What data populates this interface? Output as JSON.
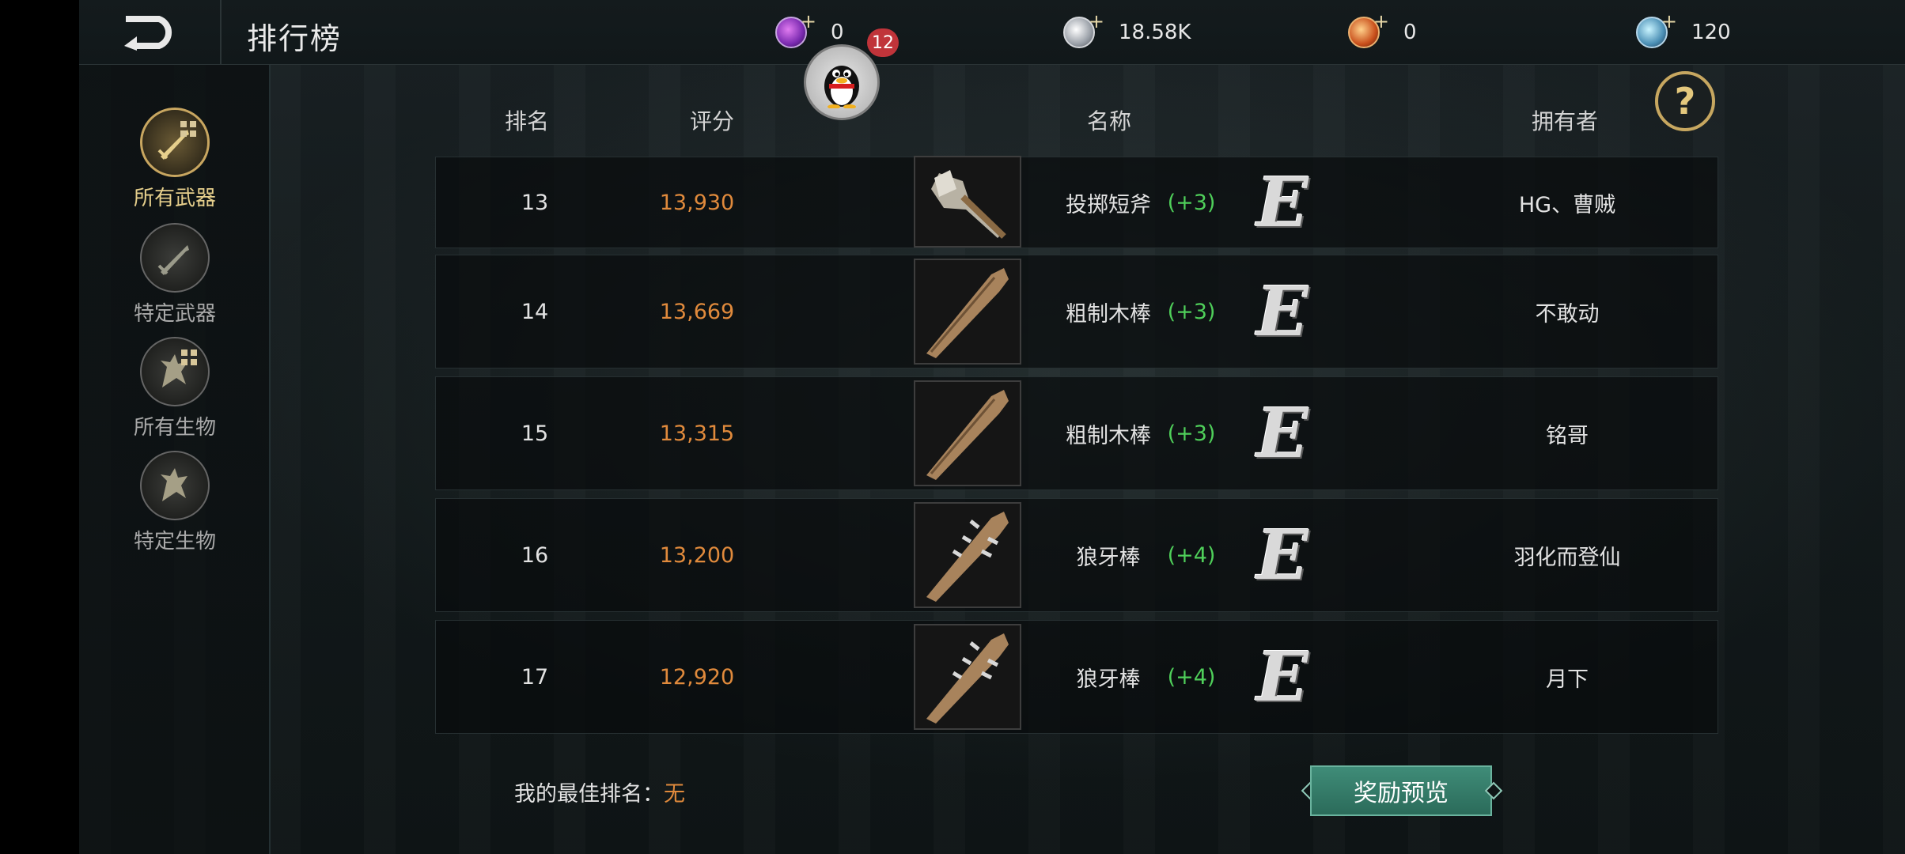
{
  "header": {
    "title": "排行榜",
    "currencies": [
      {
        "icon": "purple-gem-icon",
        "value": "0"
      },
      {
        "icon": "silver-coin-icon",
        "value": "18.58K"
      },
      {
        "icon": "gold-coin-icon",
        "value": "0"
      },
      {
        "icon": "blue-gem-icon",
        "value": "120"
      }
    ],
    "notification_count": "12",
    "help_label": "?"
  },
  "sidebar": {
    "items": [
      {
        "label": "所有武器",
        "active": true
      },
      {
        "label": "特定武器",
        "active": false
      },
      {
        "label": "所有生物",
        "active": false
      },
      {
        "label": "特定生物",
        "active": false
      }
    ]
  },
  "table": {
    "headers": {
      "rank": "排名",
      "score": "评分",
      "name": "名称",
      "owner": "拥有者"
    },
    "rows": [
      {
        "rank": "13",
        "score": "13,930",
        "name": "投掷短斧",
        "level": "(+3)",
        "grade": "E",
        "owner": "HG、曹贼"
      },
      {
        "rank": "14",
        "score": "13,669",
        "name": "粗制木棒",
        "level": "(+3)",
        "grade": "E",
        "owner": "不敢动"
      },
      {
        "rank": "15",
        "score": "13,315",
        "name": "粗制木棒",
        "level": "(+3)",
        "grade": "E",
        "owner": "铭哥"
      },
      {
        "rank": "16",
        "score": "13,200",
        "name": "狼牙棒",
        "level": "(+4)",
        "grade": "E",
        "owner": "羽化而登仙"
      },
      {
        "rank": "17",
        "score": "12,920",
        "name": "狼牙棒",
        "level": "(+4)",
        "grade": "E",
        "owner": "月下"
      }
    ]
  },
  "footer": {
    "best_rank_label": "我的最佳排名：",
    "best_rank_value": "无",
    "reward_button": "奖励预览"
  },
  "colors": {
    "score": "#e08a3c",
    "level": "#4fcf5a",
    "accent_gold": "#c8a660",
    "button_green": "#3f8c78",
    "badge_red": "#c0343a"
  }
}
